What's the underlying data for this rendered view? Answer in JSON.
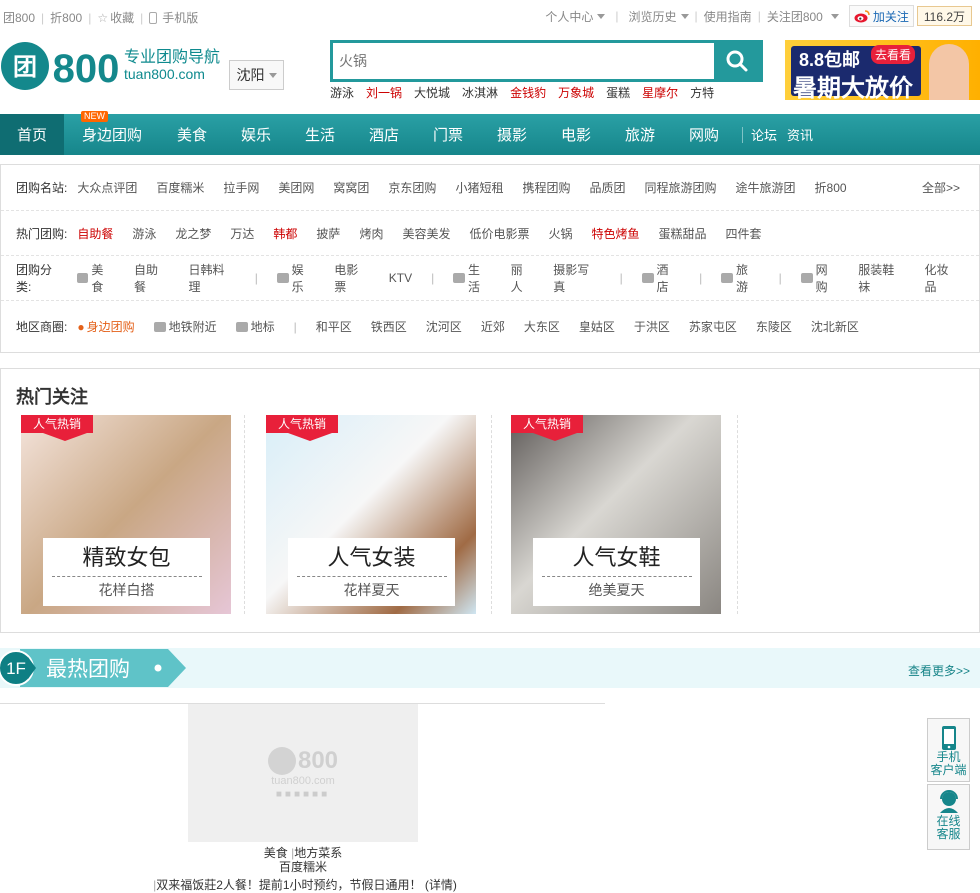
{
  "topbar": {
    "left": [
      "团800",
      "折800",
      "收藏",
      "手机版"
    ],
    "right": [
      "个人中心",
      "浏览历史",
      "使用指南",
      "关注团800"
    ],
    "weibo_follow": "加关注",
    "weibo_count": "116.2万"
  },
  "logo": {
    "brand": "800",
    "tagline": "专业团购导航",
    "domain": "tuan800.com"
  },
  "city": "沈阳",
  "search": {
    "placeholder": "火锅",
    "hot_words": [
      {
        "text": "游泳",
        "red": false
      },
      {
        "text": "刘一锅",
        "red": true
      },
      {
        "text": "大悦城",
        "red": false
      },
      {
        "text": "冰淇淋",
        "red": false
      },
      {
        "text": "金钱豹",
        "red": true
      },
      {
        "text": "万象城",
        "red": true
      },
      {
        "text": "蛋糕",
        "red": false
      },
      {
        "text": "星摩尔",
        "red": true
      },
      {
        "text": "方特",
        "red": false
      }
    ]
  },
  "ad": {
    "line1": "8.8包邮",
    "badge": "去看看",
    "line2": "暑期大放价"
  },
  "nav": {
    "new_badge": "NEW",
    "items": [
      "首页",
      "身边团购",
      "美食",
      "娱乐",
      "生活",
      "酒店",
      "门票",
      "摄影",
      "电影",
      "旅游",
      "网购"
    ],
    "extra": [
      "论坛",
      "资讯"
    ]
  },
  "filters": {
    "sites": {
      "label": "团购名站:",
      "items": [
        "大众点评团",
        "百度糯米",
        "拉手网",
        "美团网",
        "窝窝团",
        "京东团购",
        "小猪短租",
        "携程团购",
        "品质团",
        "同程旅游团购",
        "途牛旅游团",
        "折800"
      ],
      "all": "全部>>"
    },
    "hot": {
      "label": "热门团购:",
      "items": [
        {
          "text": "自助餐",
          "red": true
        },
        {
          "text": "游泳",
          "red": false
        },
        {
          "text": "龙之梦",
          "red": false
        },
        {
          "text": "万达",
          "red": false
        },
        {
          "text": "韩都",
          "red": true
        },
        {
          "text": "披萨",
          "red": false
        },
        {
          "text": "烤肉",
          "red": false
        },
        {
          "text": "美容美发",
          "red": false
        },
        {
          "text": "低价电影票",
          "red": false
        },
        {
          "text": "火锅",
          "red": false
        },
        {
          "text": "特色烤鱼",
          "red": true
        },
        {
          "text": "蛋糕甜品",
          "red": false
        },
        {
          "text": "四件套",
          "red": false
        }
      ]
    },
    "categories": {
      "label": "团购分类:",
      "groups": [
        [
          "美食",
          "自助餐",
          "日韩料理"
        ],
        [
          "娱乐",
          "电影票",
          "KTV"
        ],
        [
          "生活",
          "丽人",
          "摄影写真"
        ],
        [
          "酒店"
        ],
        [
          "旅游"
        ],
        [
          "网购",
          "服装鞋袜",
          "化妆品"
        ]
      ]
    },
    "areas": {
      "label": "地区商圈:",
      "nearby": "身边团购",
      "metro": "地铁附近",
      "landmark": "地标",
      "items": [
        "和平区",
        "铁西区",
        "沈河区",
        "近郊",
        "大东区",
        "皇姑区",
        "于洪区",
        "苏家屯区",
        "东陵区",
        "沈北新区"
      ]
    }
  },
  "hot_section": {
    "title": "热门关注",
    "cards": [
      {
        "tag": "人气热销",
        "title": "精致女包",
        "subtitle": "花样白搭"
      },
      {
        "tag": "人气热销",
        "title": "人气女装",
        "subtitle": "花样夏天"
      },
      {
        "tag": "人气热销",
        "title": "人气女鞋",
        "subtitle": "绝美夏天"
      }
    ]
  },
  "floor": {
    "num": "1F",
    "title": "最热团购",
    "more": "查看更多>>"
  },
  "deal": {
    "placeholder_logo": "800",
    "placeholder_domain": "tuan800.com",
    "category": "美食",
    "subcategory": "地方菜系",
    "merchant": "百度糯米",
    "desc": "双来福饭莊2人餐！提前1小时预约，节假日通用！",
    "detail": "(详情)"
  },
  "side": {
    "app": [
      "手机",
      "客户端"
    ],
    "service": [
      "在线",
      "客服"
    ]
  },
  "colors": {
    "teal": "#23999c",
    "red": "#c00",
    "orange": "#e4611a"
  }
}
